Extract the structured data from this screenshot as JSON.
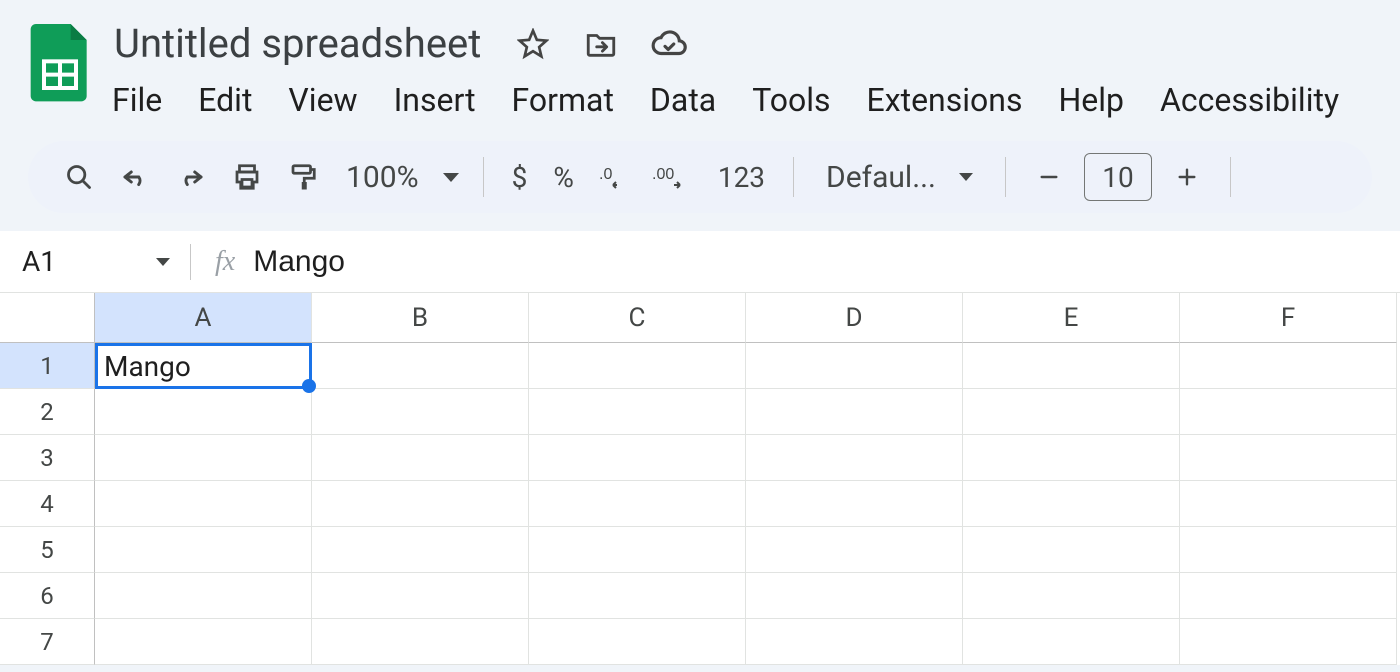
{
  "document": {
    "title": "Untitled spreadsheet"
  },
  "menubar": {
    "items": [
      "File",
      "Edit",
      "View",
      "Insert",
      "Format",
      "Data",
      "Tools",
      "Extensions",
      "Help",
      "Accessibility"
    ]
  },
  "toolbar": {
    "zoom": "100%",
    "currency_symbol": "$",
    "percent_symbol": "%",
    "format_123": "123",
    "font_family": "Defaul...",
    "font_size": "10"
  },
  "name_box": {
    "value": "A1"
  },
  "formula_bar": {
    "fx_label": "fx",
    "value": "Mango"
  },
  "grid": {
    "columns": [
      "A",
      "B",
      "C",
      "D",
      "E",
      "F"
    ],
    "rows": [
      "1",
      "2",
      "3",
      "4",
      "5",
      "6",
      "7"
    ],
    "selected_cell": "A1",
    "cell_A1": "Mango"
  }
}
